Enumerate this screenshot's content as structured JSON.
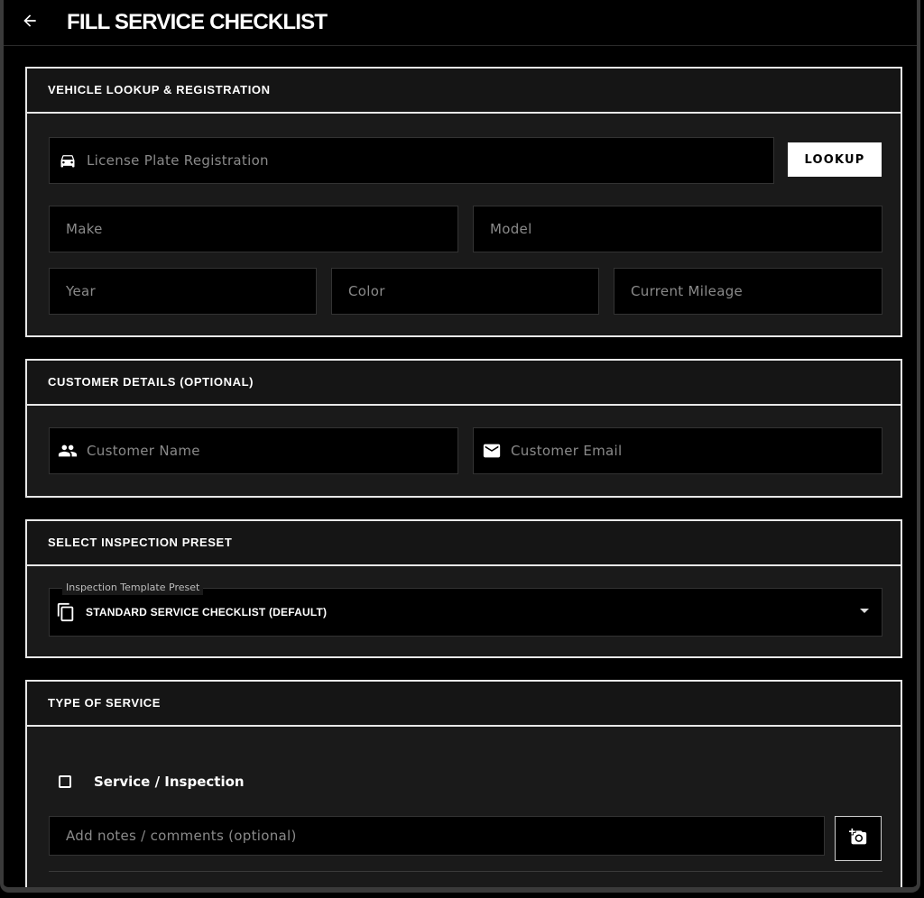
{
  "appbar": {
    "title": "FILL SERVICE CHECKLIST",
    "back_icon": "arrow-left-icon"
  },
  "vehicle": {
    "heading": "VEHICLE LOOKUP & REGISTRATION",
    "plate_placeholder": "License Plate Registration",
    "plate_icon": "car-icon",
    "lookup_label": "LOOKUP",
    "make_placeholder": "Make",
    "model_placeholder": "Model",
    "year_placeholder": "Year",
    "color_placeholder": "Color",
    "mileage_placeholder": "Current Mileage"
  },
  "customer": {
    "heading": "CUSTOMER DETAILS (OPTIONAL)",
    "name_placeholder": "Customer Name",
    "name_icon": "people-icon",
    "email_placeholder": "Customer Email",
    "email_icon": "mail-icon"
  },
  "preset": {
    "heading": "SELECT INSPECTION PRESET",
    "label": "Inspection Template Preset",
    "value": "STANDARD SERVICE CHECKLIST (DEFAULT)",
    "icon": "copy-icon"
  },
  "service": {
    "heading": "TYPE OF SERVICE",
    "checkbox_label": "Service / Inspection",
    "checked": false,
    "notes_placeholder": "Add notes / comments (optional)",
    "photo_icon": "add-photo-icon"
  }
}
